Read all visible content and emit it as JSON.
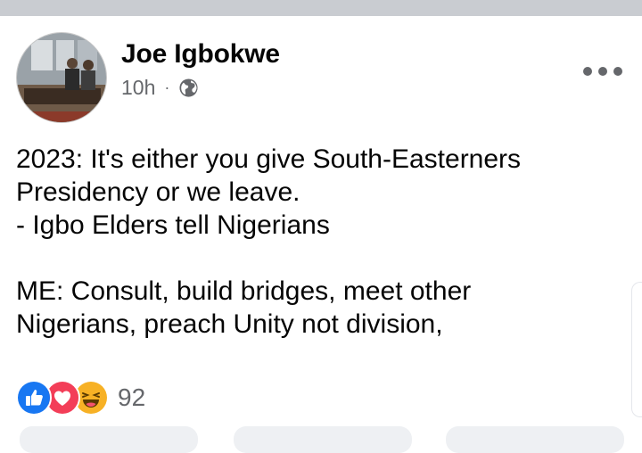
{
  "post": {
    "author": "Joe Igbokwe",
    "timestamp": "10h",
    "separator": "·",
    "privacy_icon": "globe-icon",
    "lines": [
      "2023: It's either you give South-Easterners",
      "Presidency or we leave.",
      "- Igbo Elders tell Nigerians",
      "",
      "ME: Consult, build bridges,  meet other",
      "Nigerians, preach Unity not division,"
    ],
    "reactions": {
      "icons": [
        "like-icon",
        "love-icon",
        "haha-icon"
      ],
      "count": "92"
    }
  },
  "colors": {
    "like": "#1877f2",
    "love": "#f33e58",
    "haha": "#f7b125",
    "secondary_text": "#65676b"
  }
}
